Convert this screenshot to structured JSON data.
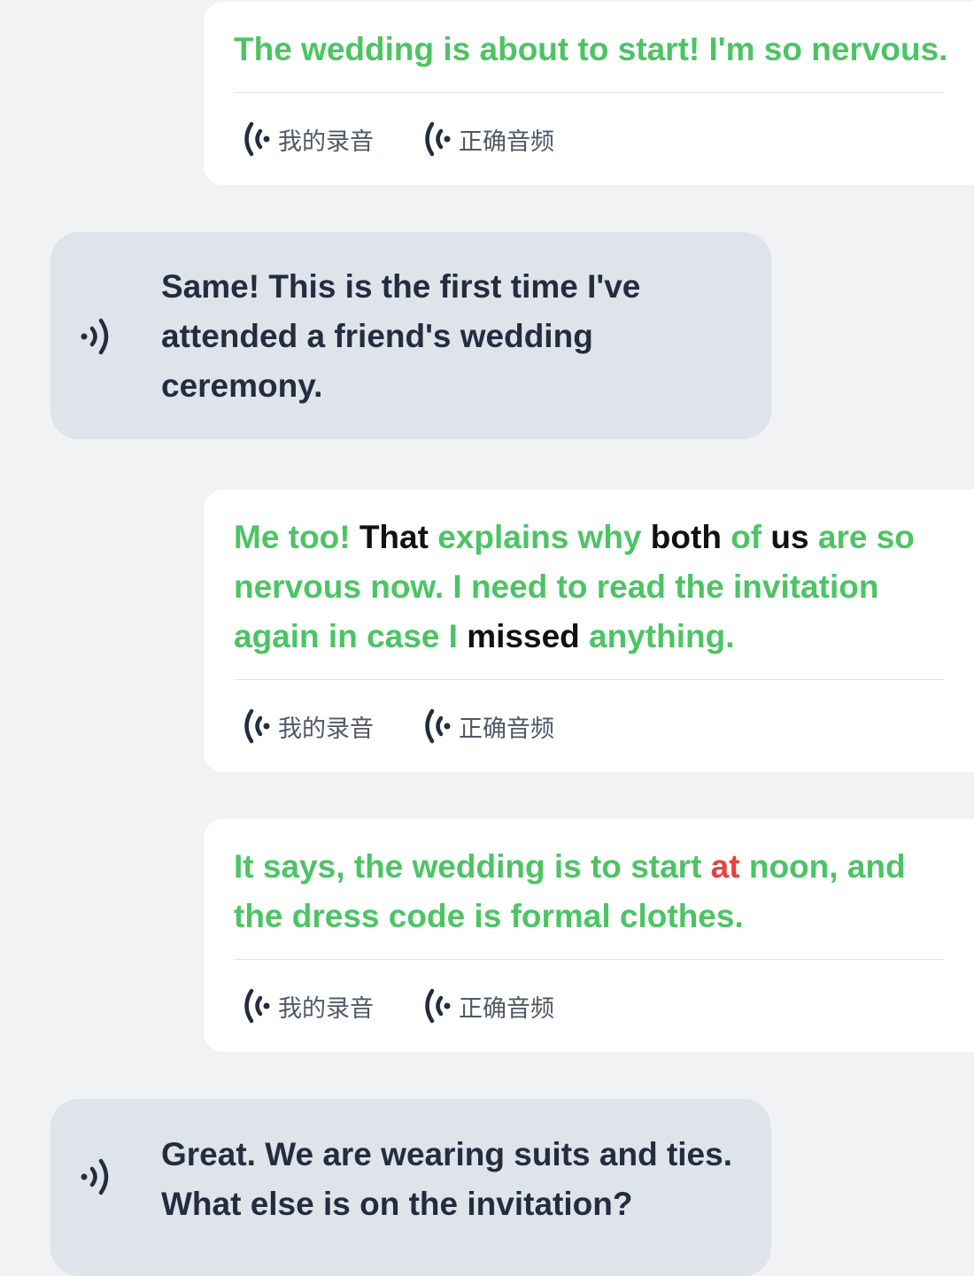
{
  "messages": [
    {
      "role": "user",
      "tokens": [
        {
          "text": "The wedding is about to start! I'm so nervous.",
          "status": "ok"
        }
      ],
      "my_recording_label": "我的录音",
      "correct_audio_label": "正确音频"
    },
    {
      "role": "bot",
      "text": "Same! This is the first time I've attended a friend's wedding ceremony.",
      "speaker_icon": "speaker-icon"
    },
    {
      "role": "user",
      "tokens": [
        {
          "text": "Me too! ",
          "status": "ok"
        },
        {
          "text": "That",
          "status": "mid"
        },
        {
          "text": " explains why ",
          "status": "ok"
        },
        {
          "text": "both",
          "status": "mid"
        },
        {
          "text": " of ",
          "status": "ok"
        },
        {
          "text": "us",
          "status": "mid"
        },
        {
          "text": " are so nervous now. I need to read the invitation again in case I ",
          "status": "ok"
        },
        {
          "text": "missed",
          "status": "mid"
        },
        {
          "text": " anything.",
          "status": "ok"
        }
      ],
      "my_recording_label": "我的录音",
      "correct_audio_label": "正确音频"
    },
    {
      "role": "user",
      "tokens": [
        {
          "text": "It says, the wedding is to start ",
          "status": "ok"
        },
        {
          "text": "at",
          "status": "bad"
        },
        {
          "text": " noon, and the dress code is formal clothes.",
          "status": "ok"
        }
      ],
      "my_recording_label": "我的录音",
      "correct_audio_label": "正确音频"
    },
    {
      "role": "bot",
      "text": "Great. We are wearing suits and ties. What else is on the invitation?",
      "speaker_icon": "speaker-icon"
    }
  ],
  "colors": {
    "correct": "#4cc464",
    "neutral": "#111111",
    "wrong": "#e84040",
    "bot_text": "#232d3f",
    "bot_bubble": "#dfe3ea",
    "background": "#f0f2f4"
  }
}
